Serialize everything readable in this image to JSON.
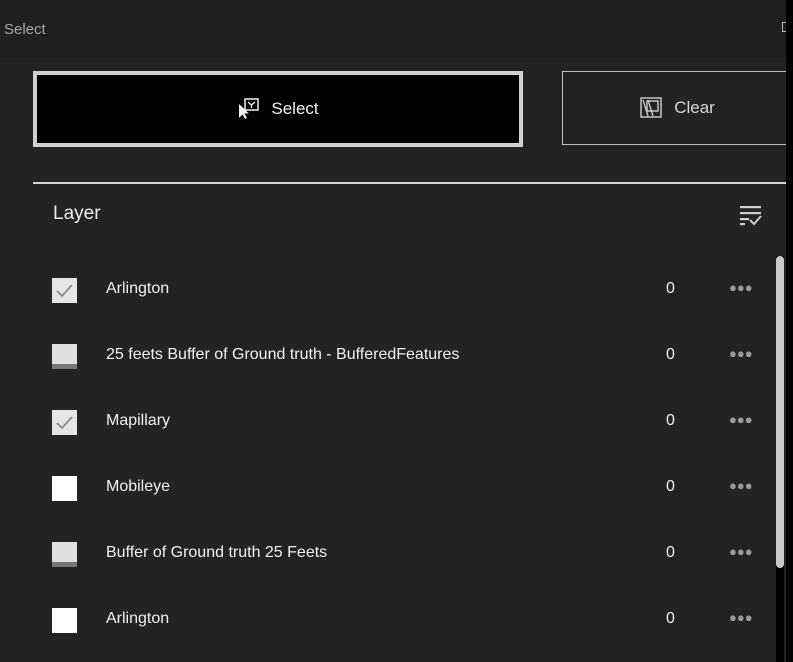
{
  "titlebar": {
    "title": "Select"
  },
  "buttons": {
    "select_label": "Select",
    "select_icon": "select-cursor-icon",
    "clear_label": "Clear",
    "clear_icon": "clear-selection-icon"
  },
  "layer_section": {
    "header": "Layer",
    "filter_icon": "filter-list-icon"
  },
  "layers": [
    {
      "label": "Arlington",
      "count": "0",
      "state": "checked"
    },
    {
      "label": "25 feets Buffer of Ground truth - BufferedFeatures",
      "count": "0",
      "state": "partial"
    },
    {
      "label": "Mapillary",
      "count": "0",
      "state": "checked"
    },
    {
      "label": "Mobileye",
      "count": "0",
      "state": "unchecked"
    },
    {
      "label": "Buffer of Ground truth 25 Feets",
      "count": "0",
      "state": "partial"
    },
    {
      "label": "Arlington",
      "count": "0",
      "state": "unchecked"
    }
  ],
  "more_glyph": "●●●",
  "colors": {
    "panel_bg": "#232323",
    "select_border": "#d0d0d0",
    "accent_text": "#f0f0f0"
  }
}
